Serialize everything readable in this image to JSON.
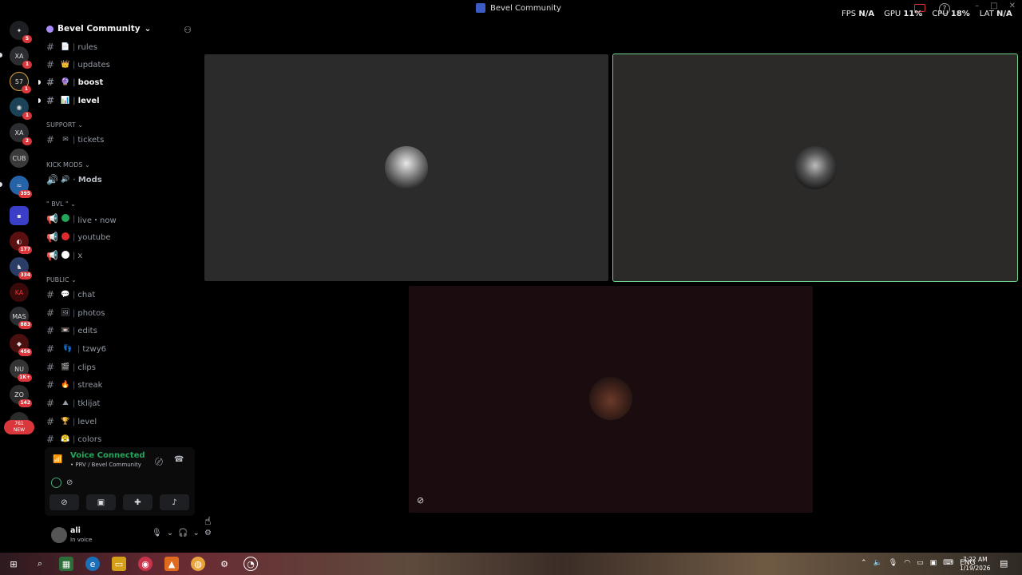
{
  "window": {
    "title": "Bevel Community",
    "controls": [
      "–",
      "□",
      "✕"
    ]
  },
  "perf": {
    "fps_label": "FPS",
    "fps_value": "N/A",
    "gpu_label": "GPU",
    "gpu_value": "11%",
    "cpu_label": "CPU",
    "cpu_value": "18%",
    "lat_label": "LAT",
    "lat_value": "N/A"
  },
  "servers": [
    {
      "name": "discord-home",
      "badge": "5",
      "label": "✦"
    },
    {
      "name": "server-1",
      "badge": "1",
      "label": "XA"
    },
    {
      "name": "server-2",
      "badge": "1",
      "label": "57"
    },
    {
      "name": "server-3",
      "badge": "1",
      "label": "◉"
    },
    {
      "name": "server-4",
      "badge": "2",
      "label": "XA"
    },
    {
      "name": "server-5",
      "badge": "",
      "label": "CUB"
    },
    {
      "name": "server-6",
      "badge": "395",
      "label": "≈"
    },
    {
      "name": "server-folder",
      "badge": "",
      "label": "▪"
    },
    {
      "name": "server-7",
      "badge": "177",
      "label": "◐"
    },
    {
      "name": "server-8",
      "badge": "334",
      "label": "♞"
    },
    {
      "name": "server-9",
      "badge": "",
      "label": "KA"
    },
    {
      "name": "server-10",
      "badge": "883",
      "label": "MAS"
    },
    {
      "name": "server-11",
      "badge": "456",
      "label": "◆"
    },
    {
      "name": "server-12",
      "badge": "1K+",
      "label": "NU"
    },
    {
      "name": "server-13",
      "badge": "142",
      "label": "ZO"
    },
    {
      "name": "server-14",
      "badge": "761\nNEW",
      "label": "◎"
    }
  ],
  "sidebar": {
    "server_name": "Bevel Community",
    "channels_top": [
      {
        "name": "rules",
        "emoji": "📄",
        "bright": false
      },
      {
        "name": "updates",
        "emoji": "👑",
        "bright": false
      },
      {
        "name": "boost",
        "emoji": "🔮",
        "bright": true
      },
      {
        "name": "level",
        "emoji": "📊",
        "bright": true
      }
    ],
    "cat_support": "SUPPORT",
    "support_channels": [
      {
        "name": "tickets",
        "emoji": "✉"
      }
    ],
    "cat_kick_mods": "KICK MODS",
    "kick_channel": "Mods",
    "cat_bvl": "\" BVL \"",
    "bvl_channels": [
      {
        "name": "live・now",
        "color": "#23a55a"
      },
      {
        "name": "youtube",
        "color": "#e02b2b"
      },
      {
        "name": "x",
        "color": "#ffffff"
      }
    ],
    "cat_public": "PUBLIC",
    "public_channels": [
      {
        "name": "chat",
        "emoji": "💬"
      },
      {
        "name": "photos",
        "emoji": "🖼"
      },
      {
        "name": "edits",
        "emoji": "📼"
      },
      {
        "name": "tzwy6",
        "emoji": "👣"
      },
      {
        "name": "clips",
        "emoji": "🎬"
      },
      {
        "name": "streak",
        "emoji": "🔥"
      },
      {
        "name": "tklijat",
        "emoji": "⛰"
      },
      {
        "name": "level",
        "emoji": "🏆"
      },
      {
        "name": "colors",
        "emoji": "😤"
      }
    ]
  },
  "voice": {
    "status": "Voice Connected",
    "location": "• PRV / Bevel Community"
  },
  "user": {
    "name": "ali",
    "status": "In voice"
  },
  "taskbar": {
    "lang": "ENG",
    "time": "7:22 AM",
    "date": "1/19/2026"
  },
  "colors": {
    "accent_green": "#23a55a",
    "speaking_outline": "#6fd38a",
    "badge_red": "#da373c"
  }
}
